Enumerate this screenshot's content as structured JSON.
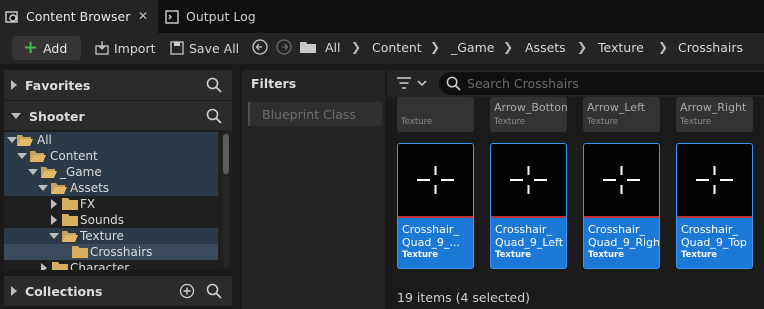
{
  "tabs": [
    {
      "label": "Content Browser",
      "active": true,
      "icon": "content-browser-icon"
    },
    {
      "label": "Output Log",
      "active": false,
      "icon": "output-log-icon"
    }
  ],
  "toolbar": {
    "add_label": "Add",
    "import_label": "Import",
    "save_all_label": "Save All"
  },
  "breadcrumb": [
    "All",
    "Content",
    "_Game",
    "Assets",
    "Texture",
    "Crosshairs"
  ],
  "sections": {
    "favorites": "Favorites",
    "shooter": "Shooter",
    "collections": "Collections"
  },
  "tree": [
    {
      "label": "All",
      "expanded": true
    },
    {
      "label": "Content",
      "expanded": true
    },
    {
      "label": "_Game",
      "expanded": true
    },
    {
      "label": "Assets",
      "expanded": true
    },
    {
      "label": "FX",
      "expanded": false
    },
    {
      "label": "Sounds",
      "expanded": false
    },
    {
      "label": "Texture",
      "expanded": true
    },
    {
      "label": "Crosshairs",
      "selected": true
    },
    {
      "label": "Character",
      "expanded": false
    }
  ],
  "filters": {
    "title": "Filters",
    "chip": "Blueprint Class"
  },
  "search": {
    "placeholder": "Search Crosshairs"
  },
  "top_tiles": [
    {
      "name": "",
      "type": "Texture"
    },
    {
      "name": "Arrow_Bottom",
      "type": "Texture"
    },
    {
      "name": "Arrow_Left",
      "type": "Texture"
    },
    {
      "name": "Arrow_Right",
      "type": "Texture"
    }
  ],
  "tiles": [
    {
      "name1": "Crosshair_",
      "name2": "Quad_9_...",
      "type": "Texture",
      "selected": true
    },
    {
      "name1": "Crosshair_",
      "name2": "Quad_9_Left",
      "type": "Texture",
      "selected": true
    },
    {
      "name1": "Crosshair_",
      "name2": "Quad_9_Right",
      "type": "Texture",
      "selected": true
    },
    {
      "name1": "Crosshair_",
      "name2": "Quad_9_Top",
      "type": "Texture",
      "selected": true
    }
  ],
  "status": "19 items (4 selected)",
  "colors": {
    "accent_selected": "#1c78d6",
    "add_plus": "#3fb948",
    "tree_selected": "#3a4a5a"
  }
}
